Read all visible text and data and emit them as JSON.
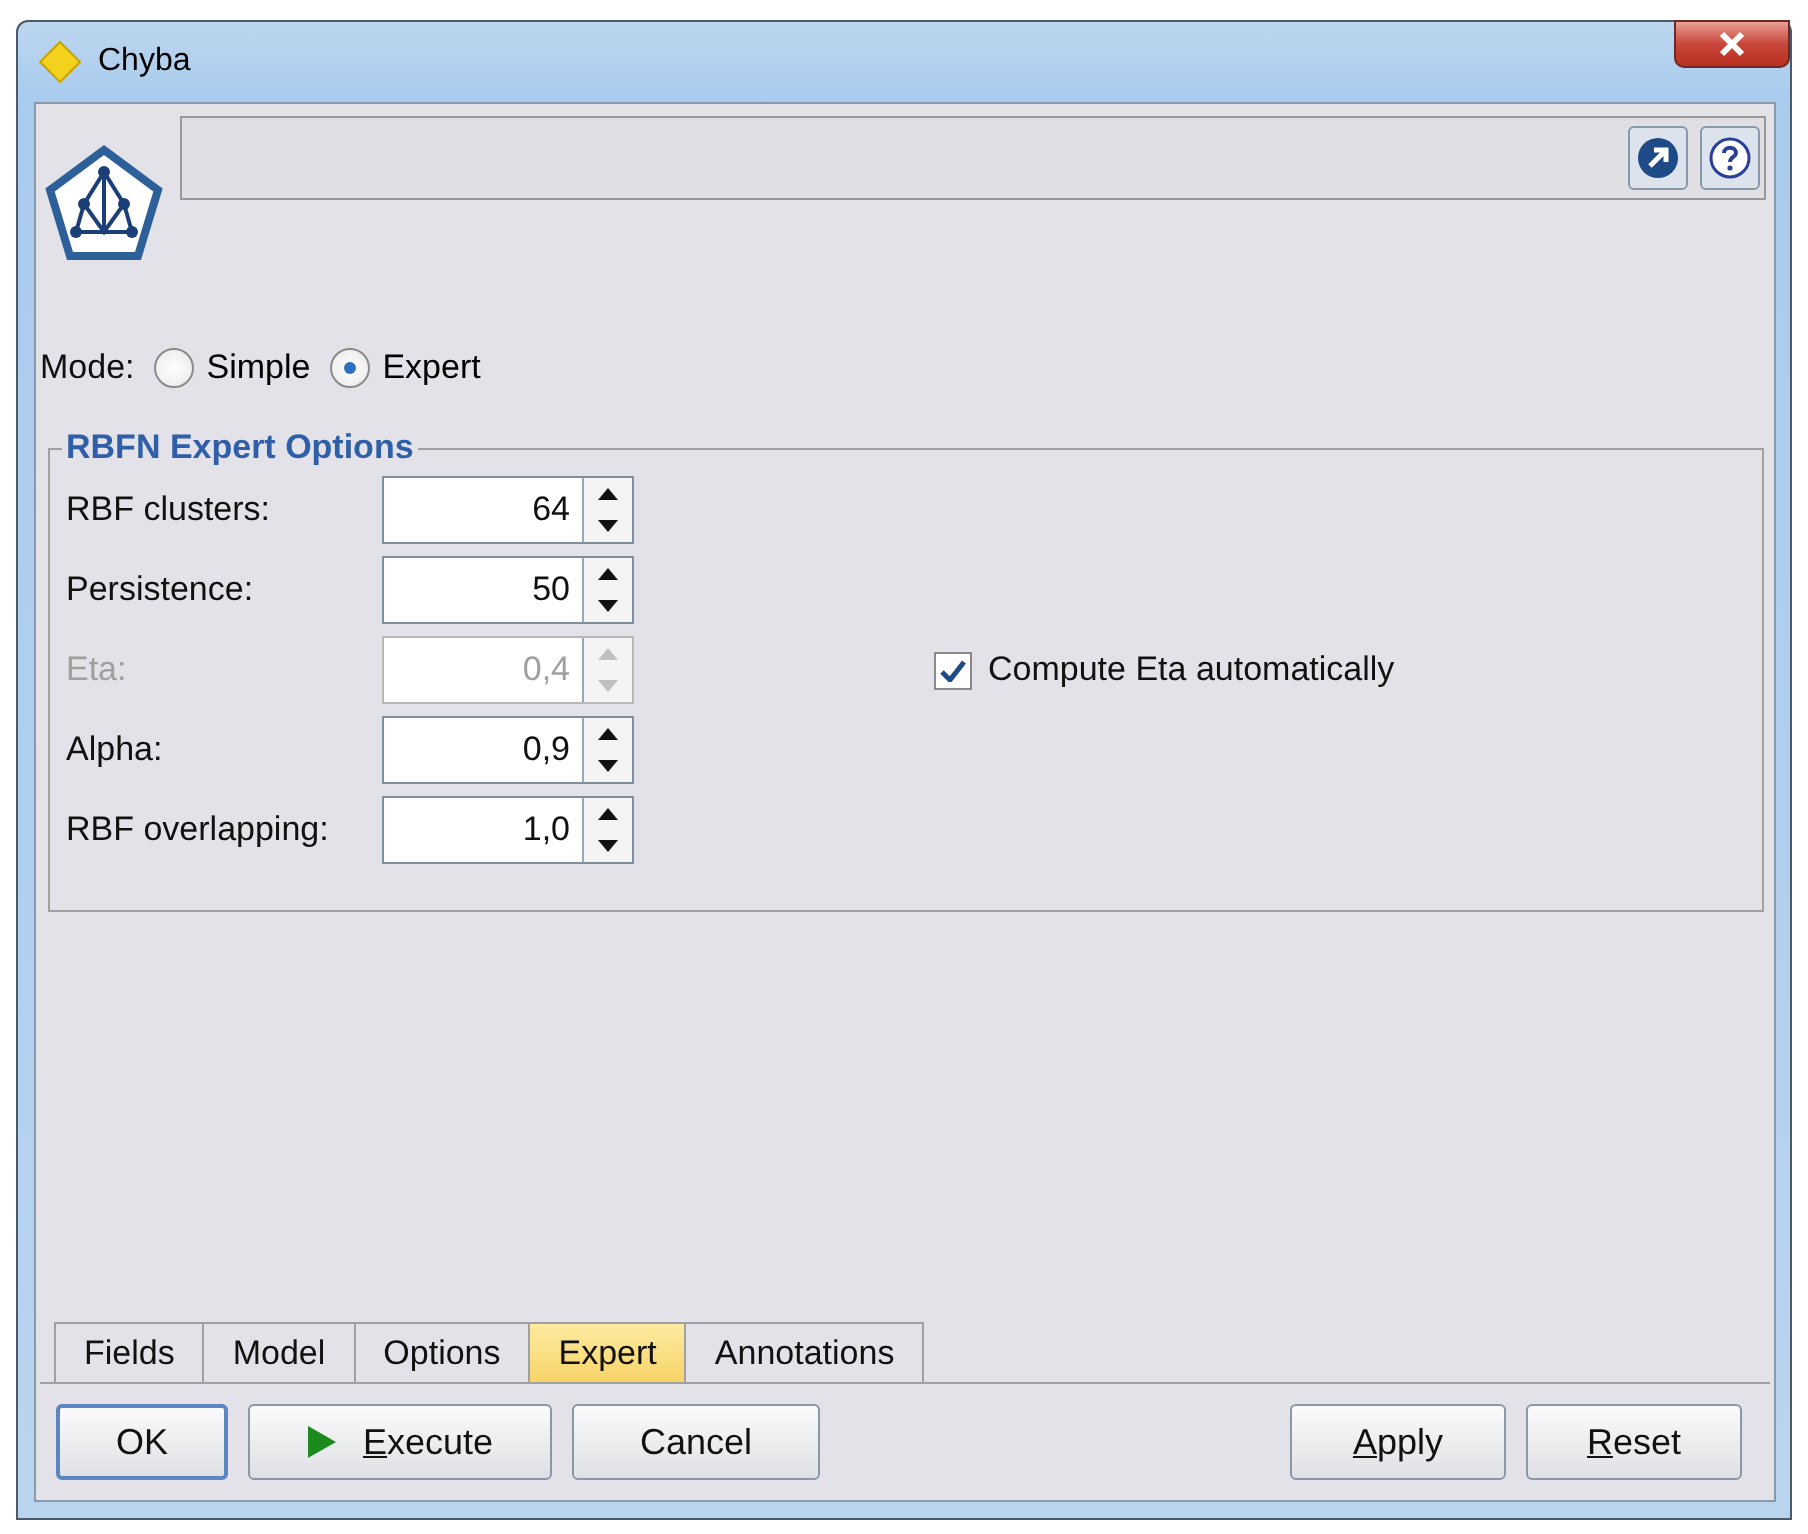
{
  "window": {
    "title": "Chyba"
  },
  "mode": {
    "label": "Mode:",
    "options": [
      {
        "label": "Simple",
        "selected": false
      },
      {
        "label": "Expert",
        "selected": true
      }
    ]
  },
  "group": {
    "title": "RBFN Expert Options",
    "fields": [
      {
        "label": "RBF clusters:",
        "value": "64",
        "disabled": false
      },
      {
        "label": "Persistence:",
        "value": "50",
        "disabled": false
      },
      {
        "label": "Eta:",
        "value": "0,4",
        "disabled": true
      },
      {
        "label": "Alpha:",
        "value": "0,9",
        "disabled": false
      },
      {
        "label": "RBF overlapping:",
        "value": "1,0",
        "disabled": false
      }
    ],
    "checkbox": {
      "label": "Compute Eta automatically",
      "checked": true
    }
  },
  "tabs": [
    {
      "label": "Fields",
      "selected": false
    },
    {
      "label": "Model",
      "selected": false
    },
    {
      "label": "Options",
      "selected": false
    },
    {
      "label": "Expert",
      "selected": true
    },
    {
      "label": "Annotations",
      "selected": false
    }
  ],
  "buttons": [
    {
      "label": "OK",
      "kind": "default",
      "mnemonic": false
    },
    {
      "label": "Execute",
      "kind": "run",
      "mnemonic": true
    },
    {
      "label": "Cancel",
      "kind": "plain",
      "mnemonic": false
    },
    {
      "label": "Apply",
      "kind": "right",
      "mnemonic": true
    },
    {
      "label": "Reset",
      "kind": "right",
      "mnemonic": true
    }
  ]
}
